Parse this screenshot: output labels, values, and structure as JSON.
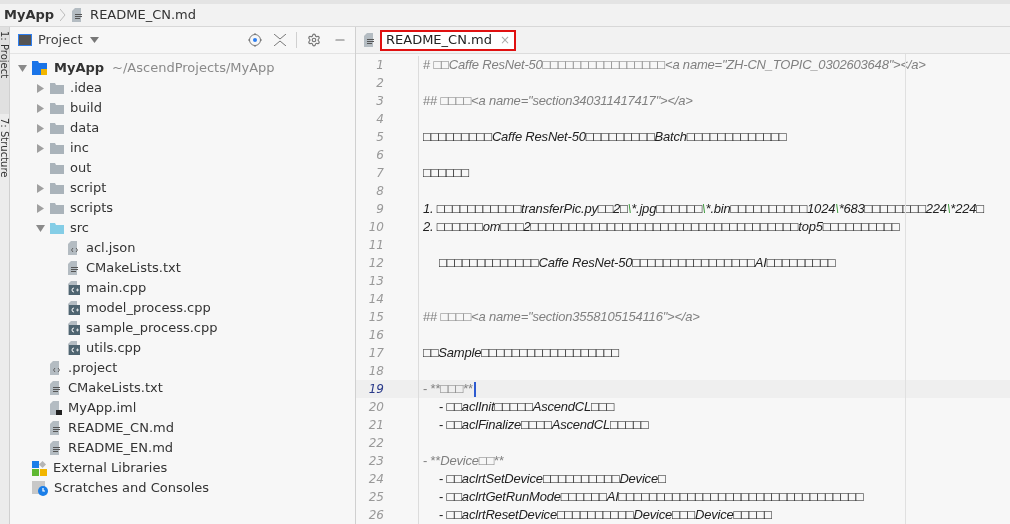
{
  "breadcrumb": {
    "project": "MyApp",
    "file": "README_CN.md"
  },
  "tool_strip": [
    {
      "label": "1: Project",
      "selected": true
    },
    {
      "label": "7: Structure",
      "selected": false
    }
  ],
  "project_panel": {
    "title": "Project",
    "tree": [
      {
        "name": "MyApp",
        "path": "~/AscendProjects/MyApp",
        "kind": "module",
        "expanded": true,
        "children": [
          {
            "name": ".idea",
            "kind": "folder",
            "expanded": false
          },
          {
            "name": "build",
            "kind": "folder",
            "expanded": false
          },
          {
            "name": "data",
            "kind": "folder",
            "expanded": false
          },
          {
            "name": "inc",
            "kind": "folder",
            "expanded": false
          },
          {
            "name": "out",
            "kind": "folder"
          },
          {
            "name": "script",
            "kind": "folder",
            "expanded": false
          },
          {
            "name": "scripts",
            "kind": "folder",
            "expanded": false
          },
          {
            "name": "src",
            "kind": "source",
            "expanded": true,
            "children": [
              {
                "name": "acl.json",
                "kind": "json"
              },
              {
                "name": "CMakeLists.txt",
                "kind": "text"
              },
              {
                "name": "main.cpp",
                "kind": "cpp"
              },
              {
                "name": "model_process.cpp",
                "kind": "cpp"
              },
              {
                "name": "sample_process.cpp",
                "kind": "cpp"
              },
              {
                "name": "utils.cpp",
                "kind": "cpp"
              }
            ]
          },
          {
            "name": ".project",
            "kind": "json"
          },
          {
            "name": "CMakeLists.txt",
            "kind": "text"
          },
          {
            "name": "MyApp.iml",
            "kind": "iml"
          },
          {
            "name": "README_CN.md",
            "kind": "text"
          },
          {
            "name": "README_EN.md",
            "kind": "text"
          }
        ]
      },
      {
        "name": "External Libraries",
        "kind": "libraries"
      },
      {
        "name": "Scratches and Consoles",
        "kind": "scratches"
      }
    ]
  },
  "editor": {
    "tabs": [
      {
        "label": "README_CN.md",
        "selected": true,
        "close": "×"
      }
    ],
    "lines": [
      {
        "number": "1",
        "current": false,
        "indented": false,
        "segments": [
          {
            "kind": "mark",
            "text": "# □□"
          },
          {
            "kind": "tag",
            "text": "Caffe ResNet-50"
          },
          {
            "kind": "mark",
            "text": "□□□□□□□□□□□□□□□□"
          },
          {
            "kind": "tag",
            "text": "<a name=\"ZH-CN_TOPIC_0302603648\"></a>"
          }
        ]
      },
      {
        "number": "2",
        "current": false
      },
      {
        "number": "3",
        "current": false,
        "indented": false,
        "segments": [
          {
            "kind": "mark",
            "text": "## □□□□"
          },
          {
            "kind": "tag",
            "text": "<a name=\"section340311417417\"></a>"
          }
        ]
      },
      {
        "number": "4",
        "current": false
      },
      {
        "number": "5",
        "current": false,
        "indented": false,
        "segments": [
          {
            "kind": "text",
            "text": "□□□□□□□□□"
          },
          {
            "kind": "em",
            "text": "Caffe ResNet-50"
          },
          {
            "kind": "text",
            "text": "□□□□□□□□□"
          },
          {
            "kind": "em",
            "text": "Batch"
          },
          {
            "kind": "text",
            "text": "□□□□□□□□□□□□□"
          }
        ]
      },
      {
        "number": "6",
        "current": false
      },
      {
        "number": "7",
        "current": false,
        "indented": false,
        "segments": [
          {
            "kind": "text",
            "text": "□□□□□□"
          }
        ]
      },
      {
        "number": "8",
        "current": false
      },
      {
        "number": "9",
        "current": false,
        "indented": false,
        "segments": [
          {
            "kind": "em",
            "text": "1.   "
          },
          {
            "kind": "text",
            "text": "□□□□□□□□□□□"
          },
          {
            "kind": "em",
            "text": "transferPic.py"
          },
          {
            "kind": "text",
            "text": "□□"
          },
          {
            "kind": "em",
            "text": "2"
          },
          {
            "kind": "text",
            "text": "□"
          },
          {
            "kind": "esc",
            "text": "\\"
          },
          {
            "kind": "em",
            "text": "*.jpg"
          },
          {
            "kind": "text",
            "text": "□□□□□□"
          },
          {
            "kind": "esc",
            "text": "\\"
          },
          {
            "kind": "em",
            "text": "*.bin"
          },
          {
            "kind": "text",
            "text": "□□□□□□□□□□"
          },
          {
            "kind": "em",
            "text": "1024"
          },
          {
            "kind": "esc",
            "text": "\\"
          },
          {
            "kind": "em",
            "text": "*683"
          },
          {
            "kind": "text",
            "text": "□□□□□□□□"
          },
          {
            "kind": "em",
            "text": "224"
          },
          {
            "kind": "esc",
            "text": "\\"
          },
          {
            "kind": "em",
            "text": "*224"
          },
          {
            "kind": "text",
            "text": "□"
          }
        ]
      },
      {
        "number": "10",
        "current": false,
        "indented": false,
        "segments": [
          {
            "kind": "em",
            "text": "2.   "
          },
          {
            "kind": "text",
            "text": "□□□□□□"
          },
          {
            "kind": "em",
            "text": "om"
          },
          {
            "kind": "text",
            "text": "□□□"
          },
          {
            "kind": "em",
            "text": "2"
          },
          {
            "kind": "text",
            "text": "□□□□□□□□□□□□□□□□□□□□□□□□□□□□□□□□□□□"
          },
          {
            "kind": "em",
            "text": "top5"
          },
          {
            "kind": "text",
            "text": "□□□□□□□□□□"
          }
        ]
      },
      {
        "number": "11",
        "current": false
      },
      {
        "number": "12",
        "current": false,
        "indented": true,
        "segments": [
          {
            "kind": "text",
            "text": "□□□□□□□□□□□□□"
          },
          {
            "kind": "em",
            "text": "Caffe ResNet-50"
          },
          {
            "kind": "text",
            "text": "□□□□□□□□□□□□□□□□"
          },
          {
            "kind": "em",
            "text": "AI"
          },
          {
            "kind": "text",
            "text": "□□□□□□□□□"
          }
        ]
      },
      {
        "number": "13",
        "current": false
      },
      {
        "number": "14",
        "current": false
      },
      {
        "number": "15",
        "current": false,
        "indented": false,
        "segments": [
          {
            "kind": "mark",
            "text": "## □□□□"
          },
          {
            "kind": "tag",
            "text": "<a name=\"section3558105154116\"></a>"
          }
        ]
      },
      {
        "number": "16",
        "current": false
      },
      {
        "number": "17",
        "current": false,
        "indented": false,
        "segments": [
          {
            "kind": "text",
            "text": "□□"
          },
          {
            "kind": "em",
            "text": "Sample"
          },
          {
            "kind": "text",
            "text": "□□□□□□□□□□□□□□□□□□"
          }
        ]
      },
      {
        "number": "18",
        "current": false
      },
      {
        "number": "19",
        "current": true,
        "indented": false,
        "segments": [
          {
            "kind": "mark",
            "text": "-   **□□□**"
          }
        ]
      },
      {
        "number": "20",
        "current": false,
        "indented": true,
        "segments": [
          {
            "kind": "text",
            "text": "-   □□"
          },
          {
            "kind": "em",
            "text": "aclInit"
          },
          {
            "kind": "text",
            "text": "□□□□□"
          },
          {
            "kind": "em",
            "text": "AscendCL"
          },
          {
            "kind": "text",
            "text": "□□□"
          }
        ]
      },
      {
        "number": "21",
        "current": false,
        "indented": true,
        "segments": [
          {
            "kind": "text",
            "text": "-   □□"
          },
          {
            "kind": "em",
            "text": "aclFinalize"
          },
          {
            "kind": "text",
            "text": "□□□□"
          },
          {
            "kind": "em",
            "text": "AscendCL"
          },
          {
            "kind": "text",
            "text": "□□□□□"
          }
        ]
      },
      {
        "number": "22",
        "current": false
      },
      {
        "number": "23",
        "current": false,
        "indented": false,
        "segments": [
          {
            "kind": "mark",
            "text": "-   **"
          },
          {
            "kind": "tag",
            "text": "Device"
          },
          {
            "kind": "mark",
            "text": "□□**"
          }
        ]
      },
      {
        "number": "24",
        "current": false,
        "indented": true,
        "segments": [
          {
            "kind": "text",
            "text": "-   □□"
          },
          {
            "kind": "em",
            "text": "aclrtSetDevice"
          },
          {
            "kind": "text",
            "text": "□□□□□□□□□□"
          },
          {
            "kind": "em",
            "text": "Device"
          },
          {
            "kind": "text",
            "text": "□"
          }
        ]
      },
      {
        "number": "25",
        "current": false,
        "indented": true,
        "segments": [
          {
            "kind": "text",
            "text": "-   □□"
          },
          {
            "kind": "em",
            "text": "aclrtGetRunMode"
          },
          {
            "kind": "text",
            "text": "□□□□□□"
          },
          {
            "kind": "em",
            "text": "AI"
          },
          {
            "kind": "text",
            "text": "□□□□□□□□□□□□□□□□□□□□□□□□□□□□□□□□"
          }
        ]
      },
      {
        "number": "26",
        "current": false,
        "indented": true,
        "segments": [
          {
            "kind": "text",
            "text": "-   □□"
          },
          {
            "kind": "em",
            "text": "aclrtResetDevice"
          },
          {
            "kind": "text",
            "text": "□□□□□□□□□□"
          },
          {
            "kind": "em",
            "text": "Device"
          },
          {
            "kind": "text",
            "text": "□□□"
          },
          {
            "kind": "em",
            "text": "Device"
          },
          {
            "kind": "text",
            "text": "□□□□□"
          }
        ]
      }
    ]
  }
}
